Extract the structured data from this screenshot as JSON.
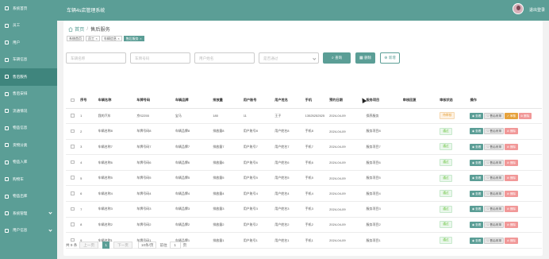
{
  "app": {
    "title": "车辆4s店管理系统",
    "logout": "退出登录"
  },
  "sidebar": {
    "items": [
      {
        "label": "系统首页",
        "icon": "home-icon",
        "active": false
      },
      {
        "label": "员工",
        "icon": "user-icon",
        "active": false
      },
      {
        "label": "用户",
        "icon": "user-icon",
        "active": false
      },
      {
        "label": "车辆信息",
        "icon": "car-icon",
        "active": false
      },
      {
        "label": "售后服务",
        "icon": "service-icon",
        "active": true
      },
      {
        "label": "售后安排",
        "icon": "calendar-icon",
        "active": false
      },
      {
        "label": "流通情况",
        "icon": "chart-icon",
        "active": false
      },
      {
        "label": "物品信息",
        "icon": "box-icon",
        "active": false
      },
      {
        "label": "货物分类",
        "icon": "tag-icon",
        "active": false
      },
      {
        "label": "物品入库",
        "icon": "import-icon",
        "active": false
      },
      {
        "label": "购物车",
        "icon": "cart-icon",
        "active": false
      },
      {
        "label": "物品出库",
        "icon": "export-icon",
        "active": false
      },
      {
        "label": "系统管理",
        "icon": "gear-icon",
        "active": false
      },
      {
        "label": "用户信息",
        "icon": "profile-icon",
        "active": false
      }
    ]
  },
  "breadcrumb": {
    "home": "首页",
    "current": "售后服务"
  },
  "tabs": [
    "系统首页",
    "员工",
    "车辆信息",
    "售后服务"
  ],
  "search": {
    "vehicle_name": "车辆名称",
    "plate": "车牌号码",
    "user_name": "用户姓名",
    "audit": "是否通过",
    "query": "查询",
    "delete": "删除",
    "add": "新增"
  },
  "table": {
    "headers": [
      "序号",
      "车辆名称",
      "车牌号码",
      "车辆品牌",
      "排放量",
      "用户账号",
      "用户姓名",
      "手机",
      "预约日期",
      "服务项目",
      "审核回复",
      "审核状态",
      "操作"
    ],
    "rows": [
      [
        "1",
        "我的汽车",
        "京S2255",
        "宝马",
        "180",
        "11",
        "王子",
        "13525252525",
        "2024-04-09",
        "保养服务",
        "",
        "待审核"
      ],
      [
        "2",
        "车辆名称8",
        "车牌号码8",
        "车辆品牌8",
        "排放量8",
        "用户账号8",
        "用户姓名8",
        "手机8",
        "2024-04-09",
        "服务项目8",
        "",
        "通过"
      ],
      [
        "3",
        "车辆名称7",
        "车牌号码7",
        "车辆品牌7",
        "排放量7",
        "用户账号7",
        "用户姓名7",
        "手机7",
        "2024-04-09",
        "服务项目7",
        "",
        "通过"
      ],
      [
        "4",
        "车辆名称6",
        "车牌号码6",
        "车辆品牌6",
        "排放量6",
        "用户账号6",
        "用户姓名6",
        "手机6",
        "2024-04-09",
        "服务项目6",
        "",
        "通过"
      ],
      [
        "5",
        "车辆名称5",
        "车牌号码5",
        "车辆品牌5",
        "排放量5",
        "用户账号5",
        "用户姓名5",
        "手机5",
        "2024-04-09",
        "服务项目5",
        "",
        "通过"
      ],
      [
        "6",
        "车辆名称4",
        "车牌号码4",
        "车辆品牌4",
        "排放量4",
        "用户账号4",
        "用户姓名4",
        "手机4",
        "2024-04-09",
        "服务项目4",
        "",
        "通过"
      ],
      [
        "7",
        "车辆名称3",
        "车牌号码3",
        "车辆品牌3",
        "排放量3",
        "用户账号3",
        "用户姓名3",
        "手机3",
        "2024-04-09",
        "服务项目3",
        "",
        "通过"
      ],
      [
        "8",
        "车辆名称2",
        "车牌号码2",
        "车辆品牌2",
        "排放量2",
        "用户账号2",
        "用户姓名2",
        "手机2",
        "2024-04-09",
        "服务项目2",
        "",
        "通过"
      ],
      [
        "9",
        "车辆名称1",
        "车牌号码1",
        "车辆品牌1",
        "排放量1",
        "用户账号1",
        "用户姓名1",
        "手机1",
        "2024-04-09",
        "服务项目1",
        "",
        "通过"
      ]
    ],
    "ops": {
      "view": "查看",
      "after": "售后安排",
      "audit": "审核",
      "delete": "删除"
    }
  },
  "pager": {
    "total": "共 9 条",
    "prev": "上一页",
    "page": "1",
    "next": "下一页",
    "size": "10条/页",
    "goto": "前往",
    "input": "1",
    "unit": "页"
  },
  "colors": {
    "primary": "#5b9e96",
    "sidebar": "#5b9e96",
    "sidebar_active": "#3f857d",
    "warning": "#e6a23c",
    "danger": "#f19898"
  }
}
